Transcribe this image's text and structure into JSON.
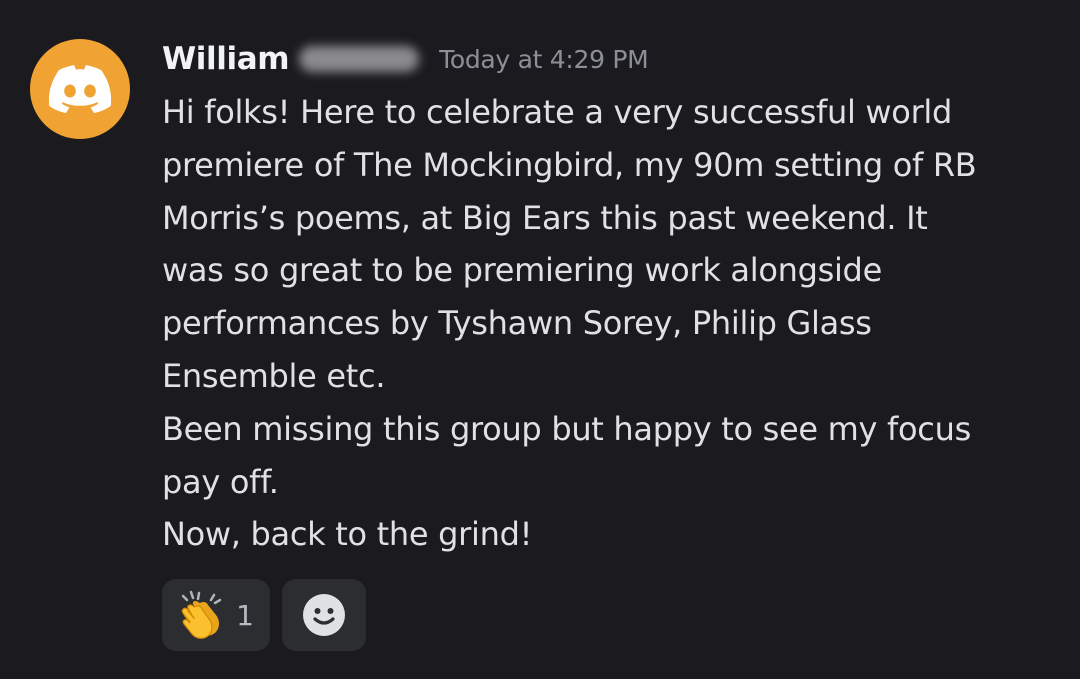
{
  "message": {
    "author": "William",
    "timestamp": "Today at 4:29 PM",
    "lines": [
      "Hi folks! Here to celebrate a very successful world",
      "premiere of The Mockingbird, my 90m setting of RB",
      "Morris’s poems, at Big Ears this past weekend.  It",
      "was so great to be premiering work alongside",
      "performances by Tyshawn Sorey, Philip Glass",
      "Ensemble etc.",
      "Been missing this group but happy to see my focus",
      "pay off.",
      "Now, back to the grind!"
    ]
  },
  "avatar": {
    "icon": "discord-logo-icon",
    "color": "#f0a232"
  },
  "reactions": [
    {
      "emoji": "clapping-hands-icon",
      "count": "1"
    },
    {
      "emoji": "add-reaction-smiley-icon"
    }
  ],
  "colors": {
    "background": "#1b1b1f",
    "username": "#f2f3f5",
    "text": "#e0e1e5",
    "timestamp": "#8c8f96",
    "reaction_bg": "#2b2d31"
  }
}
